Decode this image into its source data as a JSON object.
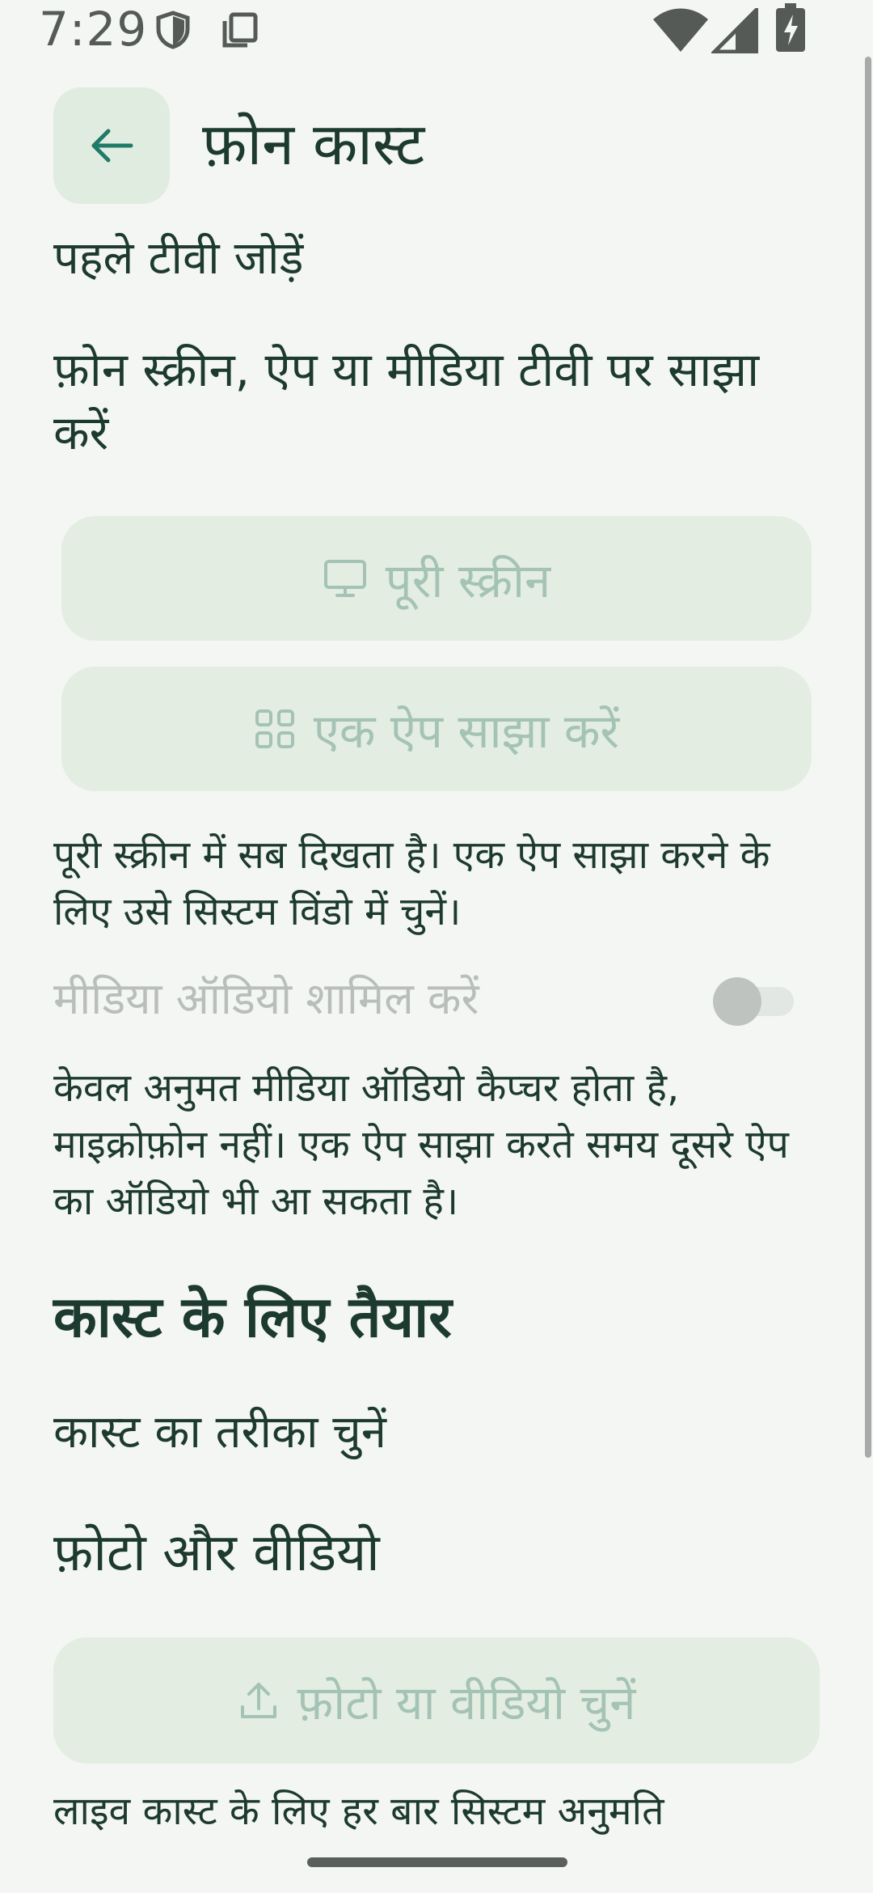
{
  "status_bar": {
    "time": "7:29",
    "icons": [
      "shield-icon",
      "copy-icon",
      "wifi-icon",
      "signal-icon",
      "battery-charging-icon"
    ]
  },
  "header": {
    "back_icon": "arrow-left-icon",
    "title": "फ़ोन कास्ट"
  },
  "main": {
    "subtitle": "पहले टीवी जोड़ें",
    "section_desc": "फ़ोन स्क्रीन, ऐप या मीडिया टीवी पर साझा करें",
    "full_screen_button": {
      "icon": "monitor-icon",
      "label": "पूरी स्क्रीन"
    },
    "share_app_button": {
      "icon": "apps-grid-icon",
      "label": "एक ऐप साझा करें"
    },
    "help_text_1": "पूरी स्क्रीन में सब दिखता है। एक ऐप साझा करने के लिए उसे सिस्टम विंडो में चुनें।",
    "audio_toggle": {
      "label": "मीडिया ऑडियो शामिल करें",
      "state": "off"
    },
    "help_text_2": "केवल अनुमत मीडिया ऑडियो कैप्चर होता है, माइक्रोफ़ोन नहीं। एक ऐप साझा करते समय दूसरे ऐप का ऑडियो भी आ सकता है।",
    "ready_heading": "कास्ट के लिए तैयार",
    "choose_method": "कास्ट का तरीका चुनें",
    "photos_heading": "फ़ोटो और वीडियो",
    "pick_media_button": {
      "icon": "upload-icon",
      "label": "फ़ोटो या वीडियो चुनें"
    },
    "live_note": "लाइव कास्ट के लिए हर बार सिस्टम अनुमति"
  },
  "colors": {
    "background": "#f3f6f2",
    "text": "#1d3a30",
    "accent": "#1f7a66",
    "button_disabled_bg": "#e3ede2",
    "button_disabled_text": "#a4c3b5"
  }
}
